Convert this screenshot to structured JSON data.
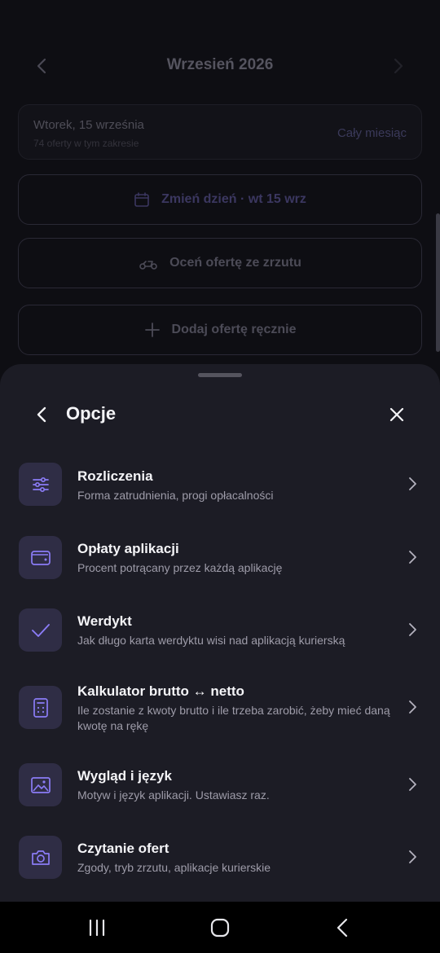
{
  "background": {
    "month_title": "Wrzesień 2026",
    "range": {
      "date": "Wtorek, 15 września",
      "count": "74 oferty w tym zakresie",
      "link": "Cały miesiąc"
    },
    "buttons": {
      "change_day": "Zmień dzień · wt 15 wrz",
      "rate_offer": "Oceń ofertę ze zrzutu",
      "add_offer": "Dodaj ofertę ręcznie"
    }
  },
  "sheet": {
    "title": "Opcje",
    "options": [
      {
        "icon": "sliders-icon",
        "title": "Rozliczenia",
        "subtitle": "Forma zatrudnienia, progi opłacalności"
      },
      {
        "icon": "wallet-icon",
        "title": "Opłaty aplikacji",
        "subtitle": "Procent potrącany przez każdą aplikację"
      },
      {
        "icon": "check-icon",
        "title": "Werdykt",
        "subtitle": "Jak długo karta werdyktu wisi nad aplikacją kurierską"
      },
      {
        "icon": "calculator-icon",
        "title": "Kalkulator brutto ↔ netto",
        "subtitle": "Ile zostanie z kwoty brutto i ile trzeba zarobić, żeby mieć daną kwotę na rękę"
      },
      {
        "icon": "image-icon",
        "title": "Wygląd i język",
        "subtitle": "Motyw i język aplikacji. Ustawiasz raz."
      },
      {
        "icon": "camera-icon",
        "title": "Czytanie ofert",
        "subtitle": "Zgody, tryb zrzutu, aplikacje kurierskie"
      }
    ]
  },
  "colors": {
    "accent": "#8b7cf6",
    "sheet_bg": "#1c1c25",
    "icon_tile": "#2f2d45"
  }
}
